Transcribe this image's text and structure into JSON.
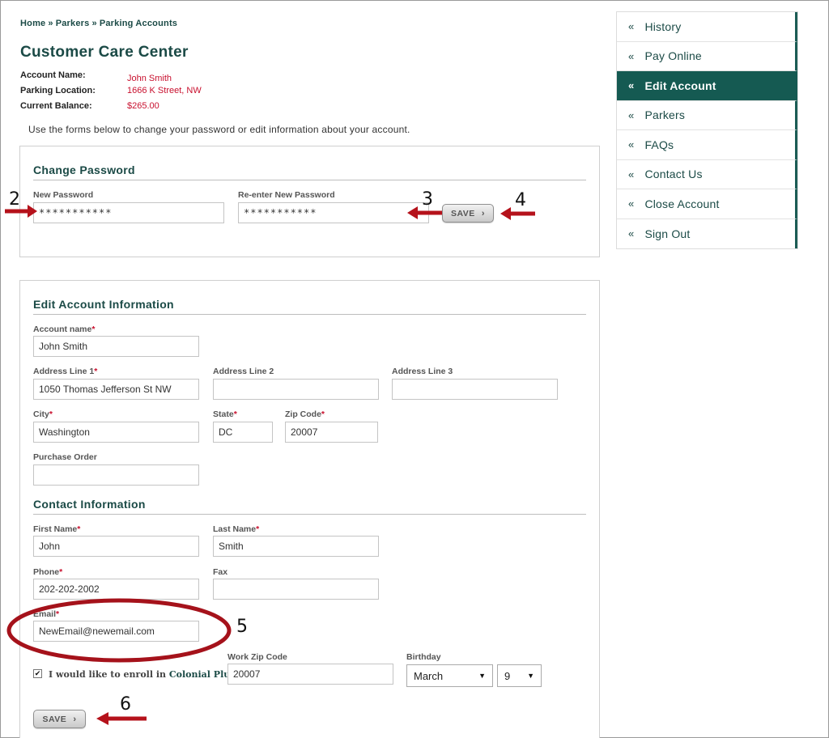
{
  "breadcrumb": {
    "home": "Home",
    "parkers": "Parkers",
    "accounts": "Parking Accounts",
    "sep": "»"
  },
  "page_title": "Customer Care Center",
  "account_info": {
    "name_label": "Account Name:",
    "name_value": "John Smith",
    "location_label": "Parking Location:",
    "location_value": "1666 K Street, NW",
    "balance_label": "Current Balance:",
    "balance_value": "$265.00"
  },
  "intro": "Use the forms below to change your password or edit information about your account.",
  "change_password": {
    "title": "Change Password",
    "new_label": "New Password",
    "new_value": "***********",
    "reenter_label": "Re-enter New Password",
    "reenter_value": "***********",
    "save_label": "SAVE"
  },
  "edit_account": {
    "title": "Edit Account Information",
    "account_name_label": "Account name",
    "account_name_value": "John Smith",
    "addr1_label": "Address Line 1",
    "addr1_value": "1050 Thomas Jefferson St NW",
    "addr2_label": "Address Line 2",
    "addr2_value": "",
    "addr3_label": "Address Line 3",
    "addr3_value": "",
    "city_label": "City",
    "city_value": "Washington",
    "state_label": "State",
    "state_value": "DC",
    "zip_label": "Zip Code",
    "zip_value": "20007",
    "po_label": "Purchase Order",
    "po_value": ""
  },
  "contact": {
    "title": "Contact Information",
    "first_label": "First Name",
    "first_value": "John",
    "last_label": "Last Name",
    "last_value": "Smith",
    "phone_label": "Phone",
    "phone_value": "202-202-2002",
    "fax_label": "Fax",
    "fax_value": "",
    "email_label": "Email",
    "email_value": "NewEmail@newemail.com",
    "enroll_text": "I would like to enroll in",
    "enroll_brand": "Colonial Plus",
    "enroll_checked": true,
    "work_zip_label": "Work Zip Code",
    "work_zip_value": "20007",
    "birthday_label": "Birthday",
    "birthday_month": "March",
    "birthday_day": "9",
    "save_label": "SAVE"
  },
  "required_mark": "*",
  "sidebar": {
    "items": [
      {
        "label": "History",
        "active": false
      },
      {
        "label": "Pay Online",
        "active": false
      },
      {
        "label": "Edit Account",
        "active": true
      },
      {
        "label": "Parkers",
        "active": false
      },
      {
        "label": "FAQs",
        "active": false
      },
      {
        "label": "Contact Us",
        "active": false
      },
      {
        "label": "Close Account",
        "active": false
      },
      {
        "label": "Sign Out",
        "active": false
      }
    ],
    "bullet": "«"
  },
  "annotations": {
    "n2": "2",
    "n3": "3",
    "n4": "4",
    "n5": "5",
    "n6": "6"
  },
  "colors": {
    "brand_green": "#1b4a46",
    "active_bg": "#155a52",
    "required_red": "#c8102e",
    "arrow_red": "#b5121b"
  },
  "icons": {
    "button_chevron": "chevron-right-icon",
    "select_caret": "caret-down-icon",
    "checkbox": "check-icon",
    "arrow": "arrow-left-icon"
  }
}
